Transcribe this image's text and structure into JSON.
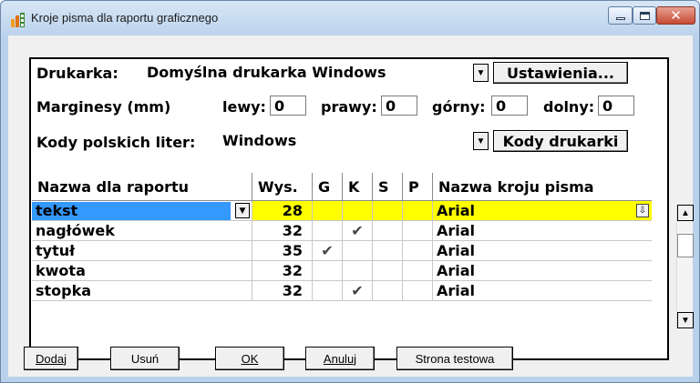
{
  "window": {
    "title": "Kroje pisma dla raportu graficznego",
    "title_buttons": {
      "minimize": "minimize",
      "maximize": "maximize",
      "close": "✕"
    }
  },
  "colors": {
    "selected_row_bg": "#ffff00",
    "selection_highlight": "#3399ff",
    "window_chrome": "#b9d1ea"
  },
  "printer": {
    "label": "Drukarka:",
    "value": "Domyślna drukarka Windows",
    "settings_button": "Ustawienia..."
  },
  "margins": {
    "label": "Marginesy (mm)",
    "left_label": "lewy:",
    "left_value": "0",
    "right_label": "prawy:",
    "right_value": "0",
    "top_label": "górny:",
    "top_value": "0",
    "bottom_label": "dolny:",
    "bottom_value": "0"
  },
  "polish_codes": {
    "label": "Kody polskich liter:",
    "value": "Windows",
    "printer_codes_button": "Kody drukarki"
  },
  "grid": {
    "columns": [
      "Nazwa dla raportu",
      "Wys.",
      "G",
      "K",
      "S",
      "P",
      "Nazwa kroju pisma"
    ],
    "rows": [
      {
        "name": "tekst",
        "height": "28",
        "g": "",
        "k": "",
        "s": "",
        "p": "",
        "font": "Arial"
      },
      {
        "name": "nagłówek",
        "height": "32",
        "g": "",
        "k": "✔",
        "s": "",
        "p": "",
        "font": "Arial"
      },
      {
        "name": "tytuł",
        "height": "35",
        "g": "✔",
        "k": "",
        "s": "",
        "p": "",
        "font": "Arial"
      },
      {
        "name": "kwota",
        "height": "32",
        "g": "",
        "k": "",
        "s": "",
        "p": "",
        "font": "Arial"
      },
      {
        "name": "stopka",
        "height": "32",
        "g": "",
        "k": "✔",
        "s": "",
        "p": "",
        "font": "Arial"
      }
    ],
    "selected_row": 0
  },
  "buttons": {
    "add": "Dodaj",
    "delete": "Usuń",
    "ok": "OK",
    "cancel": "Anuluj",
    "test_page": "Strona testowa"
  },
  "icons": {
    "combo_arrow": "▼",
    "scroll_up": "▲",
    "scroll_down": "▼",
    "font_dropdown": "⇩"
  }
}
